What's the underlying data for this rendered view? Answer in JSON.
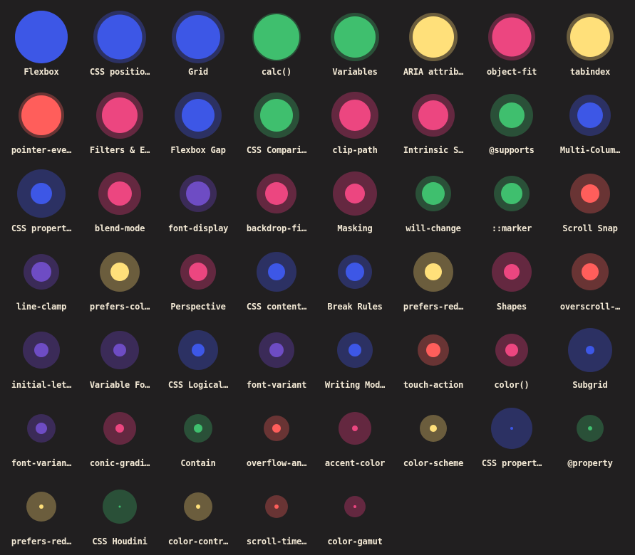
{
  "palette": {
    "blue": {
      "fill": "#3d57e6",
      "halo": "#2c3163"
    },
    "green": {
      "fill": "#3fbf6e",
      "halo": "#2a5038"
    },
    "yellow": {
      "fill": "#ffe07a",
      "halo": "#6b5d3d"
    },
    "pink": {
      "fill": "#ec4680",
      "halo": "#642840"
    },
    "red": {
      "fill": "#ff5e5b",
      "halo": "#693434"
    },
    "purple": {
      "fill": "#6e4cc4",
      "halo": "#3b2b58"
    }
  },
  "background": "#211f20",
  "items": [
    {
      "label": "Flexbox",
      "color": "blue"
    },
    {
      "label": "CSS positio…",
      "color": "blue"
    },
    {
      "label": "Grid",
      "color": "blue"
    },
    {
      "label": "calc()",
      "color": "green"
    },
    {
      "label": "Variables",
      "color": "green"
    },
    {
      "label": "ARIA attrib…",
      "color": "yellow"
    },
    {
      "label": "object-fit",
      "color": "pink"
    },
    {
      "label": "tabindex",
      "color": "yellow"
    },
    {
      "label": "pointer-eve…",
      "color": "red"
    },
    {
      "label": "Filters & E…",
      "color": "pink"
    },
    {
      "label": "Flexbox Gap",
      "color": "blue"
    },
    {
      "label": "CSS Compari…",
      "color": "green"
    },
    {
      "label": "clip-path",
      "color": "pink"
    },
    {
      "label": "Intrinsic S…",
      "color": "pink"
    },
    {
      "label": "@supports",
      "color": "green"
    },
    {
      "label": "Multi-Colum…",
      "color": "blue"
    },
    {
      "label": "CSS propert…",
      "color": "blue"
    },
    {
      "label": "blend-mode",
      "color": "pink"
    },
    {
      "label": "font-display",
      "color": "purple"
    },
    {
      "label": "backdrop-fi…",
      "color": "pink"
    },
    {
      "label": "Masking",
      "color": "pink"
    },
    {
      "label": "will-change",
      "color": "green"
    },
    {
      "label": "::marker",
      "color": "green"
    },
    {
      "label": "Scroll Snap",
      "color": "red"
    },
    {
      "label": "line-clamp",
      "color": "purple"
    },
    {
      "label": "prefers-col…",
      "color": "yellow"
    },
    {
      "label": "Perspective",
      "color": "pink"
    },
    {
      "label": "CSS content…",
      "color": "blue"
    },
    {
      "label": "Break Rules",
      "color": "blue"
    },
    {
      "label": "prefers-red…",
      "color": "yellow"
    },
    {
      "label": "Shapes",
      "color": "pink"
    },
    {
      "label": "overscroll-…",
      "color": "red"
    },
    {
      "label": "initial-let…",
      "color": "purple"
    },
    {
      "label": "Variable Fo…",
      "color": "purple"
    },
    {
      "label": "CSS Logical…",
      "color": "blue"
    },
    {
      "label": "font-variant",
      "color": "purple"
    },
    {
      "label": "Writing Mod…",
      "color": "blue"
    },
    {
      "label": "touch-action",
      "color": "red"
    },
    {
      "label": "color()",
      "color": "pink"
    },
    {
      "label": "Subgrid",
      "color": "blue"
    },
    {
      "label": "font-varian…",
      "color": "purple"
    },
    {
      "label": "conic-gradi…",
      "color": "pink"
    },
    {
      "label": "Contain",
      "color": "green"
    },
    {
      "label": "overflow-an…",
      "color": "red"
    },
    {
      "label": "accent-color",
      "color": "pink"
    },
    {
      "label": "color-scheme",
      "color": "yellow"
    },
    {
      "label": "CSS propert…",
      "color": "blue"
    },
    {
      "label": "@property",
      "color": "green"
    },
    {
      "label": "prefers-red…",
      "color": "yellow"
    },
    {
      "label": "CSS Houdini",
      "color": "green"
    },
    {
      "label": "color-contr…",
      "color": "yellow"
    },
    {
      "label": "scroll-time…",
      "color": "red"
    },
    {
      "label": "color-gamut",
      "color": "pink"
    }
  ]
}
